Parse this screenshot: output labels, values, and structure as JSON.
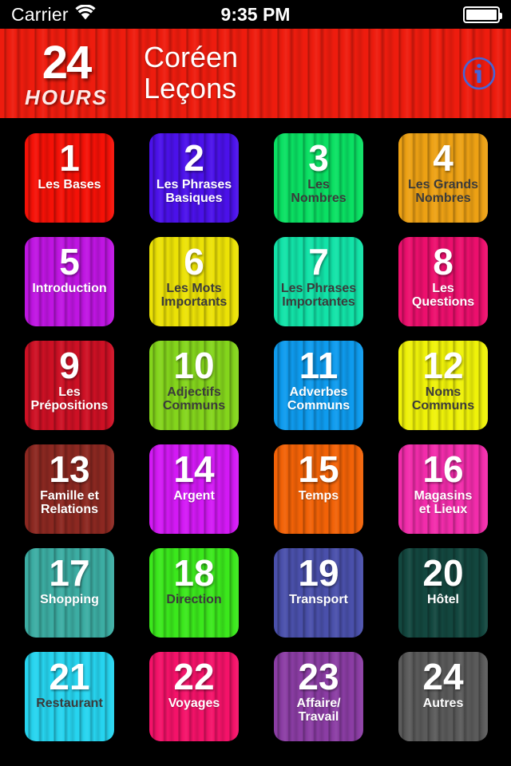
{
  "status_bar": {
    "carrier": "Carrier",
    "wifi_icon": "wifi-icon",
    "time": "9:35 PM",
    "battery_icon": "battery-icon"
  },
  "header": {
    "logo_top": "24",
    "logo_bottom": "HOURS",
    "title_line1": "Coréen",
    "title_line2": "Leçons",
    "info_icon": "info-icon",
    "background_color": "#ee1c0e",
    "info_color": "#4464d8"
  },
  "lessons": [
    {
      "number": "1",
      "label": "Les Bases",
      "color": "#f51107",
      "label_color": "light"
    },
    {
      "number": "2",
      "label": "Les Phrases\nBasiques",
      "color": "#4b11ea",
      "label_color": "light"
    },
    {
      "number": "3",
      "label": "Les\nNombres",
      "color": "#0ae063",
      "label_color": "dark"
    },
    {
      "number": "4",
      "label": "Les Grands\nNombres",
      "color": "#eda114",
      "label_color": "dark"
    },
    {
      "number": "5",
      "label": "Introduction",
      "color": "#bf15e2",
      "label_color": "light"
    },
    {
      "number": "6",
      "label": "Les Mots\nImportants",
      "color": "#ece206",
      "label_color": "dark"
    },
    {
      "number": "7",
      "label": "Les Phrases\nImportantes",
      "color": "#12e3a8",
      "label_color": "dark"
    },
    {
      "number": "8",
      "label": "Les\nQuestions",
      "color": "#ec0f6d",
      "label_color": "light"
    },
    {
      "number": "9",
      "label": "Les\nPrépositions",
      "color": "#cd1024",
      "label_color": "light"
    },
    {
      "number": "10",
      "label": "Adjectifs\nCommuns",
      "color": "#84d51c",
      "label_color": "dark"
    },
    {
      "number": "11",
      "label": "Adverbes\nCommuns",
      "color": "#0e9bee",
      "label_color": "light"
    },
    {
      "number": "12",
      "label": "Noms\nCommuns",
      "color": "#eff209",
      "label_color": "dark"
    },
    {
      "number": "13",
      "label": "Famille et\nRelations",
      "color": "#8c2821",
      "label_color": "light"
    },
    {
      "number": "14",
      "label": "Argent",
      "color": "#d319f5",
      "label_color": "light"
    },
    {
      "number": "15",
      "label": "Temps",
      "color": "#f26207",
      "label_color": "light"
    },
    {
      "number": "16",
      "label": "Magasins\net Lieux",
      "color": "#f22cab",
      "label_color": "light"
    },
    {
      "number": "17",
      "label": "Shopping",
      "color": "#3cada3",
      "label_color": "light"
    },
    {
      "number": "18",
      "label": "Direction",
      "color": "#3be81c",
      "label_color": "dark"
    },
    {
      "number": "19",
      "label": "Transport",
      "color": "#4a50ab",
      "label_color": "light"
    },
    {
      "number": "20",
      "label": "Hôtel",
      "color": "#13473f",
      "label_color": "light"
    },
    {
      "number": "21",
      "label": "Restaurant",
      "color": "#26d4ef",
      "label_color": "dark"
    },
    {
      "number": "22",
      "label": "Voyages",
      "color": "#f41269",
      "label_color": "light"
    },
    {
      "number": "23",
      "label": "Affaire/\nTravail",
      "color": "#8b3da4",
      "label_color": "light"
    },
    {
      "number": "24",
      "label": "Autres",
      "color": "#5b5b5b",
      "label_color": "light"
    }
  ]
}
